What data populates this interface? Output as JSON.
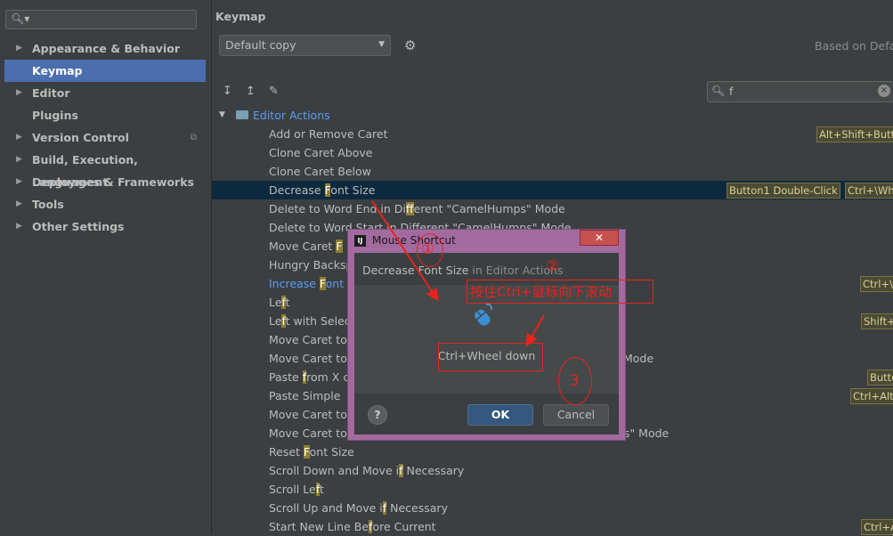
{
  "sidebar": {
    "search_placeholder": "",
    "items": [
      {
        "label": "Appearance & Behavior",
        "expandable": true
      },
      {
        "label": "Keymap",
        "expandable": false,
        "selected": true
      },
      {
        "label": "Editor",
        "expandable": true
      },
      {
        "label": "Plugins",
        "expandable": false
      },
      {
        "label": "Version Control",
        "expandable": true
      },
      {
        "label": "Build, Execution, Deployment",
        "expandable": true
      },
      {
        "label": "Languages & Frameworks",
        "expandable": true
      },
      {
        "label": "Tools",
        "expandable": true
      },
      {
        "label": "Other Settings",
        "expandable": true
      }
    ]
  },
  "header": {
    "title": "Keymap",
    "scheme": "Default copy",
    "based_on": "Based on Defa"
  },
  "filter": {
    "value": "f"
  },
  "tree": {
    "group": "Editor Actions",
    "rows": [
      {
        "pre": "Add or Remove Caret",
        "hl": "",
        "post": "",
        "shortcuts": [
          "Alt+Shift+Butto"
        ]
      },
      {
        "pre": "Clone Caret Above",
        "hl": "",
        "post": "",
        "shortcuts": []
      },
      {
        "pre": "Clone Caret Below",
        "hl": "",
        "post": "",
        "shortcuts": []
      },
      {
        "pre": "Decrease ",
        "hl": "F",
        "post": "ont Size",
        "shortcuts": [
          "Button1 Double-Click",
          "Ctrl+\\Whe"
        ],
        "selected": true
      },
      {
        "pre": "Delete to Word End in Di",
        "hl": "f",
        "post": "ferent \"CamelHumps\" Mode",
        "shortcuts": []
      },
      {
        "pre": "Delete to Word Start in Different \"CamelHumps\" Mode",
        "hl": "",
        "post": "",
        "shortcuts": []
      },
      {
        "pre": "Move Caret ",
        "hl": "F",
        "post": "",
        "shortcuts": []
      },
      {
        "pre": "Hungry Backsp",
        "hl": "",
        "post": "",
        "shortcuts": []
      },
      {
        "pre": "Increase ",
        "hl": "F",
        "post": "ont S",
        "shortcuts": [
          "Ctrl+\\"
        ],
        "blue": true
      },
      {
        "pre": "Le",
        "hl": "f",
        "post": "t",
        "shortcuts": []
      },
      {
        "pre": "Le",
        "hl": "f",
        "post": "t with Select",
        "shortcuts": [
          "Shift+"
        ]
      },
      {
        "pre": "Move Caret to",
        "hl": "",
        "post": "",
        "shortcuts": []
      },
      {
        "pre": "Move Caret to",
        "hl": "",
        "post": "",
        "tail": "Mode",
        "shortcuts": []
      },
      {
        "pre": "Paste ",
        "hl": "f",
        "post": "rom X c",
        "shortcuts": [
          "Butto"
        ]
      },
      {
        "pre": "Paste Simple",
        "hl": "",
        "post": "",
        "shortcuts": [
          "Ctrl+Alt-"
        ]
      },
      {
        "pre": "Move Caret to",
        "hl": "",
        "post": "",
        "shortcuts": []
      },
      {
        "pre": "Move Caret to",
        "hl": "",
        "post": "",
        "tail": "ps\" Mode",
        "shortcuts": []
      },
      {
        "pre": "Reset ",
        "hl": "F",
        "post": "ont Size",
        "shortcuts": []
      },
      {
        "pre": "Scroll Down and Move i",
        "hl": "f",
        "post": " Necessary",
        "shortcuts": []
      },
      {
        "pre": "Scroll Le",
        "hl": "f",
        "post": "t",
        "shortcuts": []
      },
      {
        "pre": "Scroll Up and Move i",
        "hl": "f",
        "post": " Necessary",
        "shortcuts": []
      },
      {
        "pre": "Start New Line Be",
        "hl": "f",
        "post": "ore Current",
        "shortcuts": [
          "Ctrl+A"
        ]
      }
    ]
  },
  "dialog": {
    "title": "Mouse Shortcut",
    "action_name": "Decrease Font Size",
    "action_context": " in Editor Actions",
    "captured": "Ctrl+Wheel down",
    "help": "?",
    "ok": "OK",
    "cancel": "Cancel"
  },
  "annotations": {
    "n1": "①",
    "n2": "②",
    "n3": "3",
    "instruction": "按住Ctrl+鼠标向下滚动",
    "color": "#e8231c"
  }
}
